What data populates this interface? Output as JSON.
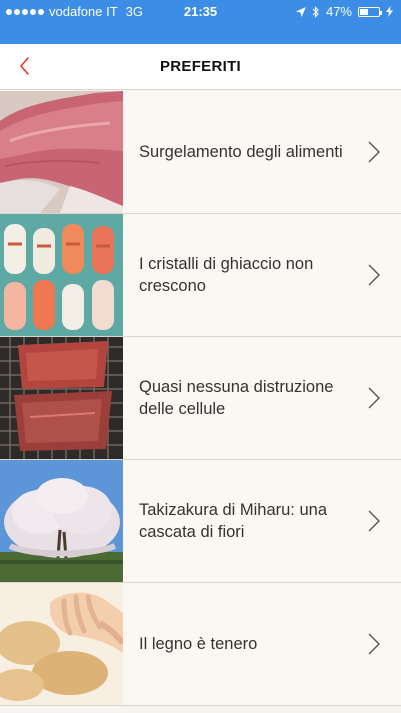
{
  "status_bar": {
    "carrier": "vodafone IT",
    "network": "3G",
    "time": "21:35",
    "battery": "47%",
    "battery_level": 0.47
  },
  "nav": {
    "title": "PREFERITI",
    "back_icon": "chevron-left-icon"
  },
  "favorites": [
    {
      "title": "Surgelamento degli alimenti",
      "image": "frozen-meat-slab"
    },
    {
      "title": "I cristalli di ghiaccio non crescono",
      "image": "frozen-sushi-packs"
    },
    {
      "title": "Quasi nessuna distruzione delle cellule",
      "image": "meat-on-grill-rack"
    },
    {
      "title": "Takizakura di Miharu: una cascata di fiori",
      "image": "weeping-cherry-tree"
    },
    {
      "title": "Il legno è tenero",
      "image": "baby-hands-wooden-toys"
    }
  ],
  "colors": {
    "status_bar_bg": "#3b8de6",
    "accent_red": "#e5352b",
    "row_bg": "#fbf8f3",
    "separator": "#d9d4cc",
    "text": "#333333"
  }
}
